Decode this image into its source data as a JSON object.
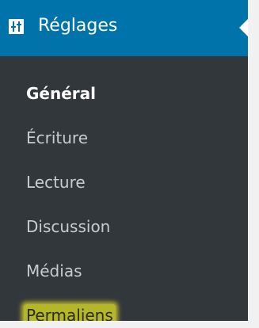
{
  "header": {
    "title": "Réglages",
    "icon": "settings-sliders-icon"
  },
  "submenu": {
    "items": [
      {
        "label": "Général",
        "current": true
      },
      {
        "label": "Écriture",
        "current": false
      },
      {
        "label": "Lecture",
        "current": false
      },
      {
        "label": "Discussion",
        "current": false
      },
      {
        "label": "Médias",
        "current": false
      },
      {
        "label": "Permaliens",
        "current": false,
        "highlighted": true
      }
    ]
  },
  "colors": {
    "menu_bg": "#32373c",
    "header_bg": "#0073aa",
    "highlight": "#b6b62a",
    "text": "#c8cccf",
    "text_current": "#ffffff"
  }
}
